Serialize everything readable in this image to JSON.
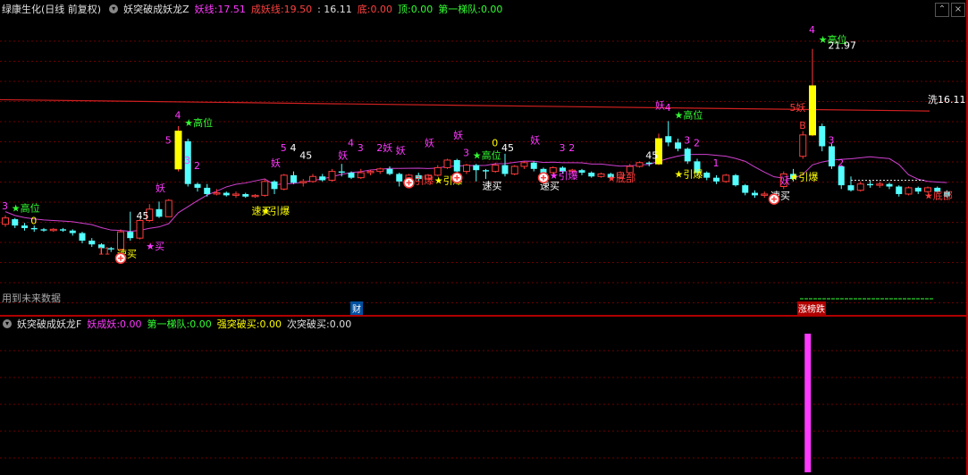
{
  "header": {
    "stock_title": "绿康生化(日线 前复权)",
    "indicator_name": "妖突破成妖龙Z",
    "yao_line_label": "妖线:",
    "yao_line_value": "17.51",
    "chengyao_label": "成妖线:",
    "chengyao_value": "19.50",
    "price_value": ": 16.11",
    "di_label": "底:",
    "di_value": "0.00",
    "ding_label": "顶:",
    "ding_value": "0.00",
    "tidui_label": "第一梯队:",
    "tidui_value": "0.00"
  },
  "window_controls": {
    "expand": "⌃",
    "close": "×"
  },
  "colors": {
    "up": "#ff3b3b",
    "down": "#54ffff",
    "magenta": "#ff39ff",
    "yellow": "#ffff00",
    "green": "#33ff33",
    "red_line": "#d02020",
    "purple_line": "#d040d0",
    "grid": "#6b0000"
  },
  "main_chart": {
    "future_data_note": "用到未来数据",
    "cai_marker": "财",
    "zhangbang_label": "涨榜跌",
    "price_label": "洗16.11",
    "high_label": "21.97",
    "candles": [
      {
        "o": 15.0,
        "c": 15.25,
        "h": 15.35,
        "l": 14.9
      },
      {
        "o": 15.2,
        "c": 14.95,
        "h": 15.25,
        "l": 14.85
      },
      {
        "o": 14.95,
        "c": 14.85,
        "h": 15.05,
        "l": 14.75
      },
      {
        "o": 14.85,
        "c": 14.8,
        "h": 14.95,
        "l": 14.7
      },
      {
        "o": 14.8,
        "c": 14.75,
        "h": 14.85,
        "l": 14.7
      },
      {
        "o": 14.75,
        "c": 14.8,
        "h": 14.85,
        "l": 14.7
      },
      {
        "o": 14.8,
        "c": 14.75,
        "h": 14.85,
        "l": 14.7
      },
      {
        "o": 14.75,
        "c": 14.65,
        "h": 14.8,
        "l": 14.55
      },
      {
        "o": 14.65,
        "c": 14.35,
        "h": 14.7,
        "l": 14.25
      },
      {
        "o": 14.35,
        "c": 14.2,
        "h": 14.45,
        "l": 14.1
      },
      {
        "o": 14.2,
        "c": 14.05,
        "h": 14.25,
        "l": 13.8
      },
      {
        "o": 14.05,
        "c": 14.0,
        "h": 14.1,
        "l": 13.9
      },
      {
        "o": 14.0,
        "c": 14.7,
        "h": 14.8,
        "l": 13.95
      },
      {
        "o": 14.7,
        "c": 14.45,
        "h": 15.5,
        "l": 14.35
      },
      {
        "o": 14.45,
        "c": 15.15,
        "h": 15.2,
        "l": 14.4
      },
      {
        "o": 15.15,
        "c": 15.6,
        "h": 15.8,
        "l": 15.1
      },
      {
        "o": 15.6,
        "c": 15.3,
        "h": 15.9,
        "l": 15.25
      },
      {
        "o": 15.3,
        "c": 15.95,
        "h": 16.0,
        "l": 15.3
      },
      {
        "o": 17.2,
        "c": 18.7,
        "h": 18.9,
        "l": 17.1
      },
      {
        "o": 18.3,
        "c": 16.6,
        "h": 18.4,
        "l": 16.5
      },
      {
        "o": 16.6,
        "c": 16.45,
        "h": 16.65,
        "l": 16.3
      },
      {
        "o": 16.45,
        "c": 16.2,
        "h": 16.6,
        "l": 16.1
      },
      {
        "o": 16.2,
        "c": 16.25,
        "h": 16.4,
        "l": 16.15
      },
      {
        "o": 16.25,
        "c": 16.15,
        "h": 16.3,
        "l": 16.1
      },
      {
        "o": 16.15,
        "c": 16.2,
        "h": 16.3,
        "l": 16.05
      },
      {
        "o": 16.2,
        "c": 16.1,
        "h": 16.25,
        "l": 16.05
      },
      {
        "o": 16.1,
        "c": 16.15,
        "h": 16.2,
        "l": 16.05
      },
      {
        "o": 16.15,
        "c": 16.7,
        "h": 16.8,
        "l": 16.1
      },
      {
        "o": 16.7,
        "c": 16.4,
        "h": 16.75,
        "l": 16.2
      },
      {
        "o": 16.4,
        "c": 16.95,
        "h": 17.0,
        "l": 16.35
      },
      {
        "o": 16.95,
        "c": 16.65,
        "h": 17.1,
        "l": 16.6
      },
      {
        "o": 16.65,
        "c": 16.7,
        "h": 16.8,
        "l": 16.5
      },
      {
        "o": 16.7,
        "c": 16.9,
        "h": 17.0,
        "l": 16.65
      },
      {
        "o": 16.9,
        "c": 16.75,
        "h": 17.0,
        "l": 16.7
      },
      {
        "o": 16.75,
        "c": 17.1,
        "h": 17.2,
        "l": 16.7
      },
      {
        "o": 17.1,
        "c": 17.05,
        "h": 17.4,
        "l": 16.9
      },
      {
        "o": 17.05,
        "c": 16.85,
        "h": 17.1,
        "l": 16.8
      },
      {
        "o": 16.85,
        "c": 17.05,
        "h": 17.2,
        "l": 16.8
      },
      {
        "o": 17.05,
        "c": 17.1,
        "h": 17.15,
        "l": 16.95
      },
      {
        "o": 17.1,
        "c": 17.2,
        "h": 17.25,
        "l": 17.0
      },
      {
        "o": 17.2,
        "c": 17.0,
        "h": 17.3,
        "l": 16.95
      },
      {
        "o": 17.0,
        "c": 16.7,
        "h": 17.05,
        "l": 16.5
      },
      {
        "o": 16.7,
        "c": 16.95,
        "h": 17.0,
        "l": 16.6
      },
      {
        "o": 16.95,
        "c": 16.8,
        "h": 17.05,
        "l": 16.7
      },
      {
        "o": 16.8,
        "c": 16.95,
        "h": 17.0,
        "l": 16.75
      },
      {
        "o": 16.95,
        "c": 17.25,
        "h": 17.35,
        "l": 16.9
      },
      {
        "o": 17.25,
        "c": 17.55,
        "h": 17.6,
        "l": 17.2
      },
      {
        "o": 17.55,
        "c": 17.1,
        "h": 17.6,
        "l": 16.9
      },
      {
        "o": 17.1,
        "c": 17.35,
        "h": 17.4,
        "l": 17.0
      },
      {
        "o": 17.35,
        "c": 17.15,
        "h": 17.4,
        "l": 16.7
      },
      {
        "o": 17.15,
        "c": 17.1,
        "h": 17.2,
        "l": 16.8
      },
      {
        "o": 17.1,
        "c": 17.35,
        "h": 17.45,
        "l": 17.05
      },
      {
        "o": 17.35,
        "c": 17.0,
        "h": 17.8,
        "l": 16.9
      },
      {
        "o": 17.0,
        "c": 17.3,
        "h": 17.35,
        "l": 16.95
      },
      {
        "o": 17.3,
        "c": 17.45,
        "h": 17.5,
        "l": 17.2
      },
      {
        "o": 17.45,
        "c": 17.2,
        "h": 17.5,
        "l": 17.1
      },
      {
        "o": 17.2,
        "c": 17.05,
        "h": 17.25,
        "l": 16.9
      },
      {
        "o": 17.05,
        "c": 17.25,
        "h": 17.3,
        "l": 17.0
      },
      {
        "o": 17.25,
        "c": 17.1,
        "h": 17.3,
        "l": 17.0
      },
      {
        "o": 17.1,
        "c": 17.15,
        "h": 17.2,
        "l": 17.0
      },
      {
        "o": 17.15,
        "c": 17.05,
        "h": 17.2,
        "l": 16.95
      },
      {
        "o": 17.05,
        "c": 16.9,
        "h": 17.1,
        "l": 16.85
      },
      {
        "o": 16.9,
        "c": 17.0,
        "h": 17.05,
        "l": 16.85
      },
      {
        "o": 17.0,
        "c": 16.85,
        "h": 17.05,
        "l": 16.8
      },
      {
        "o": 16.85,
        "c": 17.05,
        "h": 17.1,
        "l": 16.8
      },
      {
        "o": 17.05,
        "c": 17.3,
        "h": 17.4,
        "l": 17.0
      },
      {
        "o": 17.3,
        "c": 17.45,
        "h": 17.5,
        "l": 17.25
      },
      {
        "o": 17.45,
        "c": 17.4,
        "h": 17.5,
        "l": 17.3
      },
      {
        "o": 17.4,
        "c": 18.4,
        "h": 18.6,
        "l": 17.35
      },
      {
        "o": 18.5,
        "c": 18.25,
        "h": 19.1,
        "l": 18.1
      },
      {
        "o": 18.25,
        "c": 18.0,
        "h": 18.4,
        "l": 17.9
      },
      {
        "o": 18.0,
        "c": 17.5,
        "h": 18.05,
        "l": 17.4
      },
      {
        "o": 17.5,
        "c": 17.05,
        "h": 17.6,
        "l": 16.95
      },
      {
        "o": 17.05,
        "c": 16.85,
        "h": 17.1,
        "l": 16.75
      },
      {
        "o": 16.85,
        "c": 16.7,
        "h": 16.95,
        "l": 16.6
      },
      {
        "o": 16.7,
        "c": 16.95,
        "h": 17.0,
        "l": 16.65
      },
      {
        "o": 16.95,
        "c": 16.55,
        "h": 17.0,
        "l": 16.5
      },
      {
        "o": 16.55,
        "c": 16.25,
        "h": 16.6,
        "l": 16.15
      },
      {
        "o": 16.25,
        "c": 16.15,
        "h": 16.35,
        "l": 16.05
      },
      {
        "o": 16.15,
        "c": 16.2,
        "h": 16.3,
        "l": 16.05
      },
      {
        "o": 16.2,
        "c": 16.15,
        "h": 16.25,
        "l": 16.1
      },
      {
        "o": 16.5,
        "c": 17.0,
        "h": 17.1,
        "l": 16.4
      },
      {
        "o": 17.0,
        "c": 16.8,
        "h": 17.2,
        "l": 16.7
      },
      {
        "o": 17.7,
        "c": 18.55,
        "h": 18.7,
        "l": 17.6
      },
      {
        "o": 18.55,
        "c": 20.5,
        "h": 21.97,
        "l": 18.5
      },
      {
        "o": 18.9,
        "c": 18.1,
        "h": 19.0,
        "l": 17.9
      },
      {
        "o": 18.1,
        "c": 17.3,
        "h": 18.2,
        "l": 17.2
      },
      {
        "o": 17.3,
        "c": 16.55,
        "h": 17.35,
        "l": 16.4
      },
      {
        "o": 16.55,
        "c": 16.35,
        "h": 16.9,
        "l": 16.3
      },
      {
        "o": 16.35,
        "c": 16.6,
        "h": 16.7,
        "l": 16.3
      },
      {
        "o": 16.6,
        "c": 16.55,
        "h": 16.75,
        "l": 16.45
      },
      {
        "o": 16.55,
        "c": 16.6,
        "h": 16.7,
        "l": 16.45
      },
      {
        "o": 16.6,
        "c": 16.5,
        "h": 16.65,
        "l": 16.4
      },
      {
        "o": 16.5,
        "c": 16.2,
        "h": 16.55,
        "l": 16.1
      },
      {
        "o": 16.2,
        "c": 16.45,
        "h": 16.5,
        "l": 16.15
      },
      {
        "o": 16.45,
        "c": 16.3,
        "h": 16.5,
        "l": 16.2
      },
      {
        "o": 16.3,
        "c": 16.45,
        "h": 16.5,
        "l": 16.25
      },
      {
        "o": 16.45,
        "c": 16.3,
        "h": 16.5,
        "l": 16.25
      },
      {
        "o": 16.3,
        "c": 16.11,
        "h": 16.35,
        "l": 16.05
      }
    ],
    "chengyao_line": [
      19.5,
      19.5
    ],
    "annotations": [
      {
        "i": 0,
        "p": 15.6,
        "t": "3",
        "c": "magenta"
      },
      {
        "i": 1,
        "p": 15.5,
        "t": "★高位",
        "c": "green"
      },
      {
        "i": 3,
        "p": 15.0,
        "t": "0",
        "c": "yellow"
      },
      {
        "i": 10,
        "p": 13.8,
        "t": "11",
        "c": "red"
      },
      {
        "i": 12,
        "p": 13.7,
        "t": "速买",
        "c": "yellow"
      },
      {
        "i": 14,
        "p": 15.2,
        "t": "45",
        "c": "white"
      },
      {
        "i": 15,
        "p": 14.0,
        "t": "★买",
        "c": "magenta"
      },
      {
        "i": 16,
        "p": 16.3,
        "t": "妖",
        "c": "magenta"
      },
      {
        "i": 17,
        "p": 18.2,
        "t": "5",
        "c": "magenta"
      },
      {
        "i": 18,
        "p": 19.2,
        "t": "4",
        "c": "magenta"
      },
      {
        "i": 19,
        "p": 18.9,
        "t": "★高位",
        "c": "green"
      },
      {
        "i": 19,
        "p": 17.4,
        "t": "3",
        "c": "magenta"
      },
      {
        "i": 20,
        "p": 17.2,
        "t": "2",
        "c": "magenta"
      },
      {
        "i": 26,
        "p": 15.4,
        "t": "速买",
        "c": "yellow"
      },
      {
        "i": 27,
        "p": 15.4,
        "t": "★引爆",
        "c": "yellow"
      },
      {
        "i": 28,
        "p": 17.3,
        "t": "妖",
        "c": "magenta"
      },
      {
        "i": 29,
        "p": 17.9,
        "t": "5",
        "c": "magenta"
      },
      {
        "i": 30,
        "p": 17.9,
        "t": "4",
        "c": "white"
      },
      {
        "i": 31,
        "p": 17.6,
        "t": "45",
        "c": "white"
      },
      {
        "i": 35,
        "p": 17.6,
        "t": "妖",
        "c": "magenta"
      },
      {
        "i": 36,
        "p": 18.1,
        "t": "4",
        "c": "magenta"
      },
      {
        "i": 37,
        "p": 17.9,
        "t": "3",
        "c": "magenta"
      },
      {
        "i": 39,
        "p": 17.9,
        "t": "2妖",
        "c": "magenta"
      },
      {
        "i": 41,
        "p": 17.8,
        "t": "妖",
        "c": "magenta"
      },
      {
        "i": 42,
        "p": 16.6,
        "t": "★引爆",
        "c": "red"
      },
      {
        "i": 44,
        "p": 18.1,
        "t": "妖",
        "c": "magenta"
      },
      {
        "i": 45,
        "p": 16.6,
        "t": "★引爆",
        "c": "yellow"
      },
      {
        "i": 47,
        "p": 18.4,
        "t": "妖",
        "c": "magenta"
      },
      {
        "i": 48,
        "p": 17.7,
        "t": "3",
        "c": "magenta"
      },
      {
        "i": 49,
        "p": 17.6,
        "t": "★高位",
        "c": "green"
      },
      {
        "i": 50,
        "p": 16.4,
        "t": "速买",
        "c": "white"
      },
      {
        "i": 51,
        "p": 18.1,
        "t": "0",
        "c": "yellow"
      },
      {
        "i": 52,
        "p": 17.9,
        "t": "45",
        "c": "white"
      },
      {
        "i": 55,
        "p": 18.2,
        "t": "妖",
        "c": "magenta"
      },
      {
        "i": 56,
        "p": 16.4,
        "t": "速买",
        "c": "white"
      },
      {
        "i": 57,
        "p": 16.8,
        "t": "★引爆",
        "c": "magenta"
      },
      {
        "i": 58,
        "p": 17.9,
        "t": "3",
        "c": "magenta"
      },
      {
        "i": 59,
        "p": 17.9,
        "t": "2",
        "c": "magenta"
      },
      {
        "i": 63,
        "p": 16.7,
        "t": "★底部",
        "c": "red"
      },
      {
        "i": 67,
        "p": 17.6,
        "t": "45",
        "c": "white"
      },
      {
        "i": 68,
        "p": 19.6,
        "t": "妖",
        "c": "magenta"
      },
      {
        "i": 69,
        "p": 19.5,
        "t": "4",
        "c": "magenta"
      },
      {
        "i": 70,
        "p": 19.2,
        "t": "★高位",
        "c": "green"
      },
      {
        "i": 70,
        "p": 16.85,
        "t": "★引爆",
        "c": "yellow"
      },
      {
        "i": 71,
        "p": 18.2,
        "t": "3",
        "c": "magenta"
      },
      {
        "i": 72,
        "p": 18.1,
        "t": "2",
        "c": "magenta"
      },
      {
        "i": 74,
        "p": 17.3,
        "t": "1",
        "c": "magenta"
      },
      {
        "i": 80,
        "p": 16.0,
        "t": "速买",
        "c": "white"
      },
      {
        "i": 81,
        "p": 16.6,
        "t": "妖",
        "c": "magenta"
      },
      {
        "i": 82,
        "p": 16.75,
        "t": "★引爆",
        "c": "yellow"
      },
      {
        "i": 84,
        "p": 22.6,
        "t": "4",
        "c": "magenta"
      },
      {
        "i": 85,
        "p": 22.2,
        "t": "★高位",
        "c": "green"
      },
      {
        "i": 86,
        "p": 21.97,
        "t": "21.97",
        "c": "white"
      },
      {
        "i": 82,
        "p": 19.5,
        "t": "5妖",
        "c": "red"
      },
      {
        "i": 83,
        "p": 18.8,
        "t": "B",
        "c": "red"
      },
      {
        "i": 86,
        "p": 18.2,
        "t": "3",
        "c": "magenta"
      },
      {
        "i": 87,
        "p": 17.3,
        "t": "2",
        "c": "magenta"
      },
      {
        "i": 96,
        "p": 16.0,
        "t": "★底部",
        "c": "red"
      }
    ]
  },
  "sub_panel": {
    "indicator_name": "妖突破成妖龙F",
    "yaocheng_label": "妖成妖:",
    "yaocheng_value": "0.00",
    "tidui_label": "第一梯队:",
    "tidui_value": "0.00",
    "qiang_label": "强突破买:",
    "qiang_value": "0.00",
    "ci_label": "次突破买:",
    "ci_value": "0.00",
    "bar_value": 1
  }
}
